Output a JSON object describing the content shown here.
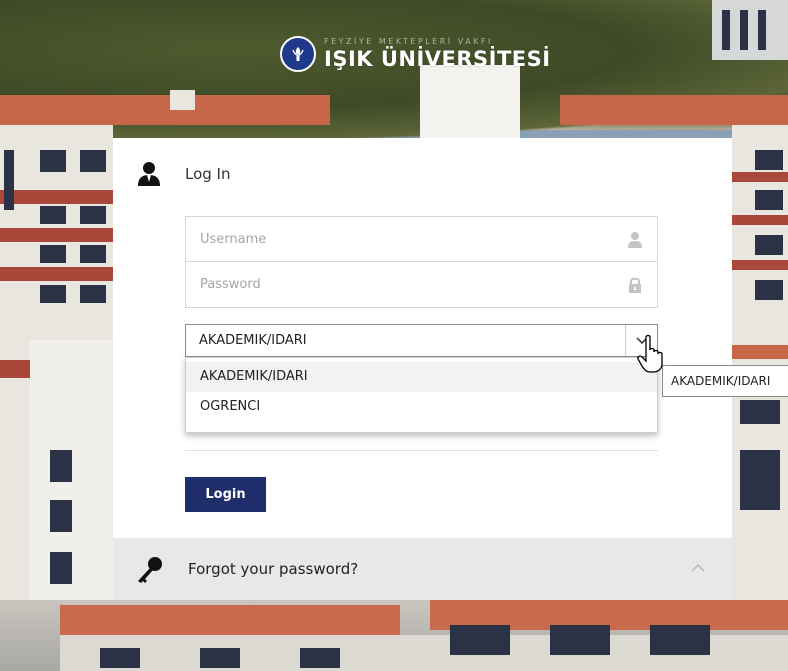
{
  "logo": {
    "subtitle": "FEYZİYE MEKTEPLERİ VAKFI",
    "name": "IŞIK ÜNİVERSİTESİ"
  },
  "login": {
    "title": "Log In",
    "username_placeholder": "Username",
    "password_placeholder": "Password",
    "user_type": {
      "selected": "AKADEMIK/IDARI",
      "options": [
        "AKADEMIK/IDARI",
        "OGRENCI"
      ]
    },
    "login_button": "Login"
  },
  "forgot": {
    "label": "Forgot your password?"
  },
  "tooltip": {
    "text": "AKADEMIK/IDARI"
  },
  "icons": {
    "user": "user-icon",
    "username_field": "person-icon",
    "password_field": "lock-icon",
    "dropdown_arrow": "chevron-down-icon",
    "forgot": "key-icon",
    "collapse": "chevron-up-icon"
  },
  "colors": {
    "login_button": "#1f2d6b",
    "logo_emblem": "#1f3a8a",
    "forgot_bg": "#e8e8e8"
  }
}
